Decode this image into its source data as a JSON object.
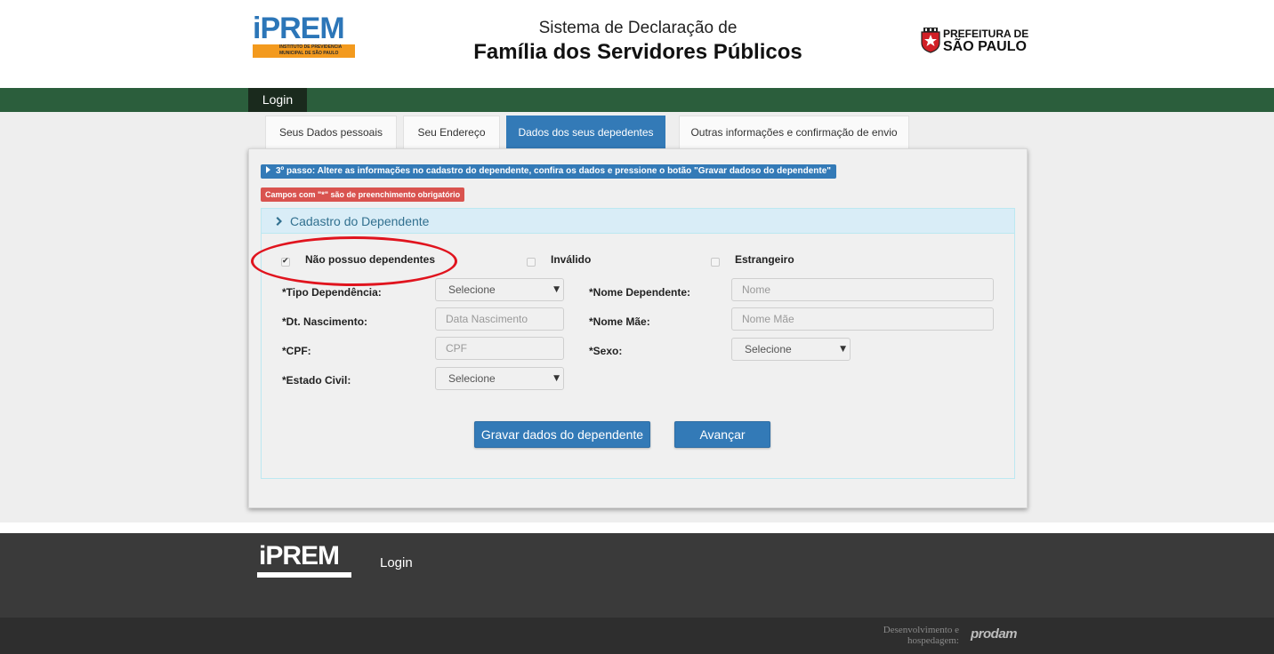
{
  "header": {
    "logo": {
      "word": "iPREM",
      "subtitle_line1": "INSTITUTO DE PREVIDÊNCIA",
      "subtitle_line2": "MUNICIPAL DE SÃO PAULO"
    },
    "title_line1": "Sistema de Declaração de",
    "title_line2": "Família dos Servidores Públicos",
    "prefeitura_line1": "PREFEITURA DE",
    "prefeitura_line2": "SÃO PAULO"
  },
  "nav": {
    "login": "Login"
  },
  "tabs": [
    {
      "label": "Seus Dados pessoais",
      "active": false
    },
    {
      "label": "Seu Endereço",
      "active": false
    },
    {
      "label": "Dados dos seus depedentes",
      "active": true
    },
    {
      "label": "Outras informações e confirmação de envio",
      "active": false
    }
  ],
  "alerts": {
    "step": "3º passo: Altere as informações no cadastro do dependente, confira os dados e pressione o botão \"Gravar dadoso do dependente\"",
    "required": "Campos com \"*\" são de preenchimento obrigatório"
  },
  "form": {
    "section_title": "Cadastro do Dependente",
    "checkboxes": [
      {
        "label": "Não possuo dependentes",
        "checked": true
      },
      {
        "label": "Inválido",
        "checked": false
      },
      {
        "label": "Estrangeiro",
        "checked": false
      }
    ],
    "tipo_dependencia": {
      "label": "*Tipo Dependência:",
      "value": "Selecione"
    },
    "dt_nascimento": {
      "label": "*Dt. Nascimento:",
      "placeholder": "Data Nascimento"
    },
    "cpf": {
      "label": "*CPF:",
      "placeholder": "CPF"
    },
    "estado_civil": {
      "label": "*Estado Civil:",
      "value": "Selecione"
    },
    "nome_dependente": {
      "label": "*Nome Dependente:",
      "placeholder": "Nome"
    },
    "nome_mae": {
      "label": "*Nome Mãe:",
      "placeholder": "Nome Mãe"
    },
    "sexo": {
      "label": "*Sexo:",
      "value": "Selecione"
    },
    "save_button": "Gravar dados do dependente",
    "next_button": "Avançar"
  },
  "footer": {
    "logo_word": "iPREM",
    "login": "Login",
    "dev_text_line1": "Desenvolvimento e",
    "dev_text_line2": "hospedagem:",
    "prodam": "prodam"
  },
  "colors": {
    "primary": "#337ab7",
    "danger": "#d9534f",
    "nav_green": "#2b5e3c",
    "annotation_red": "#e0141e",
    "iprem_orange": "#f39a1e"
  }
}
